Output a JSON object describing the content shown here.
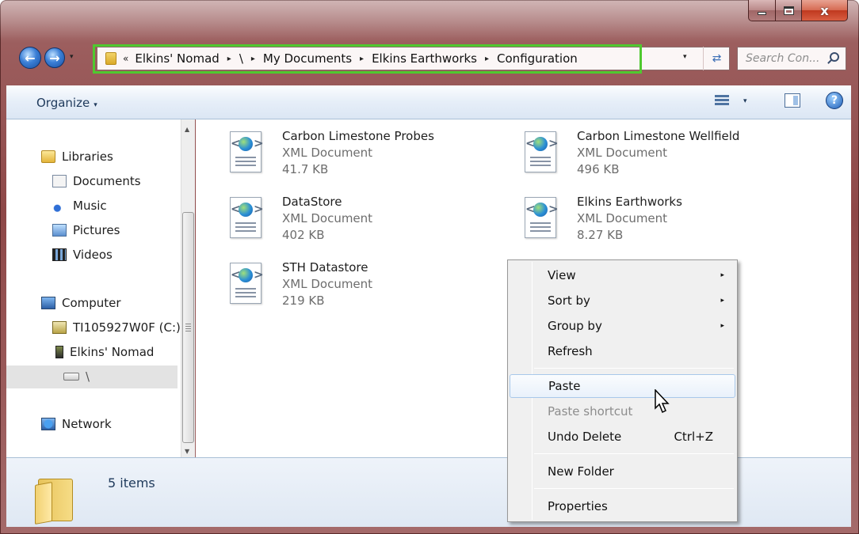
{
  "window": {
    "caption_close": "x"
  },
  "address": {
    "overflow_chevron": "«",
    "crumbs": [
      "Elkins' Nomad",
      "\\",
      "My Documents",
      "Elkins Earthworks",
      "Configuration"
    ],
    "separator": "▸",
    "dropdown": "▾"
  },
  "search": {
    "placeholder": "Search Con..."
  },
  "toolbar": {
    "organize_label": "Organize",
    "caret": "▾",
    "help": "?"
  },
  "nav_pane": {
    "items": [
      {
        "label": "Libraries",
        "icon": "libraries-icon"
      },
      {
        "label": "Documents",
        "icon": "documents-icon"
      },
      {
        "label": "Music",
        "icon": "music-icon"
      },
      {
        "label": "Pictures",
        "icon": "pictures-icon"
      },
      {
        "label": "Videos",
        "icon": "videos-icon"
      },
      {
        "label": "Computer",
        "icon": "computer-icon"
      },
      {
        "label": "TI105927W0F (C:)",
        "icon": "drive-icon"
      },
      {
        "label": "Elkins' Nomad",
        "icon": "device-icon"
      },
      {
        "label": "\\",
        "icon": "storage-icon"
      },
      {
        "label": "Network",
        "icon": "network-icon"
      }
    ]
  },
  "files": [
    {
      "name": "Carbon Limestone Probes",
      "type": "XML Document",
      "size": "41.7 KB"
    },
    {
      "name": "Carbon Limestone Wellfield",
      "type": "XML Document",
      "size": "496 KB"
    },
    {
      "name": "DataStore",
      "type": "XML Document",
      "size": "402 KB"
    },
    {
      "name": "Elkins Earthworks",
      "type": "XML Document",
      "size": "8.27 KB"
    },
    {
      "name": "STH Datastore",
      "type": "XML Document",
      "size": "219 KB"
    }
  ],
  "details": {
    "item_count": "5 items"
  },
  "context_menu": {
    "items": [
      {
        "label": "View",
        "submenu": true
      },
      {
        "label": "Sort by",
        "submenu": true
      },
      {
        "label": "Group by",
        "submenu": true
      },
      {
        "label": "Refresh"
      },
      {
        "label": "Paste",
        "hover": true
      },
      {
        "label": "Paste shortcut",
        "disabled": true
      },
      {
        "label": "Undo Delete",
        "shortcut": "Ctrl+Z"
      },
      {
        "label": "New Folder"
      },
      {
        "label": "Properties"
      }
    ],
    "submenu_arrow": "▸"
  },
  "colors": {
    "frame": "#8e4848",
    "address_highlight": "#4fc92f",
    "toolbar": "#dbe6f4"
  }
}
